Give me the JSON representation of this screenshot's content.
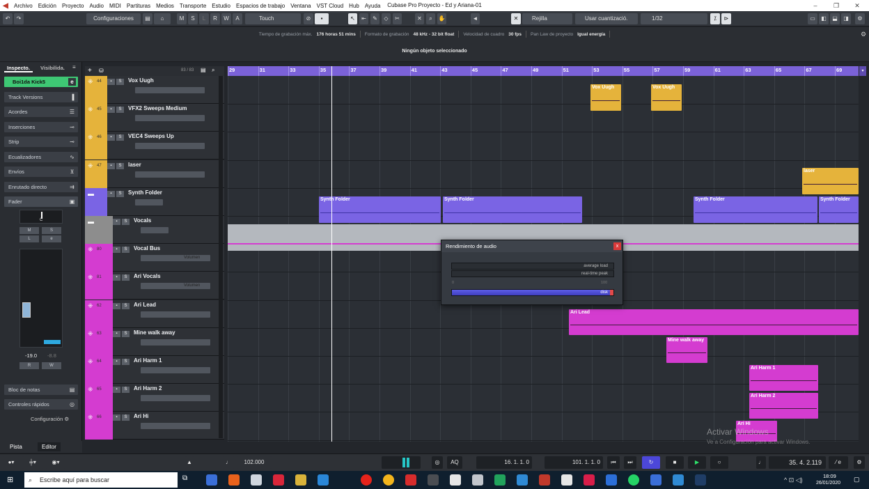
{
  "window": {
    "title": "Cubase Pro Proyecto - Ed y Ariana-01",
    "menu": [
      "Archivo",
      "Edición",
      "Proyecto",
      "Audio",
      "MIDI",
      "Partituras",
      "Medios",
      "Transporte",
      "Estudio",
      "Espacios de trabajo",
      "Ventana",
      "VST Cloud",
      "Hub",
      "Ayuda"
    ]
  },
  "toolbar": {
    "configs": "Configuraciones",
    "mode_letters": [
      "M",
      "S",
      "L",
      "R",
      "W",
      "A"
    ],
    "automation_mode": "Touch",
    "grid": "Rejilla",
    "quantize_use": "Usar cuantizació.",
    "quantize_value": "1/32"
  },
  "info": {
    "rec_time_label": "Tiempo de grabación máx.",
    "rec_time_value": "176 horas 51 mins",
    "format_label": "Formato de grabación",
    "format_value": "48 kHz - 32 bit float",
    "frame_label": "Velocidad de cuadro",
    "frame_value": "30 fps",
    "panlaw_label": "Pan Law de proyecto",
    "panlaw_value": "Igual energía",
    "selection": "Ningún objeto seleccionado"
  },
  "inspector": {
    "tab1": "Inspecto.",
    "tab2": "Visibilida.",
    "track_name": "Boi1da Kick5",
    "sections": [
      "Track Versions",
      "Acordes",
      "Inserciones",
      "Strip",
      "Ecualizadores",
      "Envíos",
      "Enrutado directo",
      "Fader"
    ],
    "fader_value": "-19.0",
    "fader_peak": "-8.8",
    "pan_value": "C",
    "bottom_sections": [
      "Bloc de notas",
      "Controles rápidos"
    ],
    "config_label": "Configuración",
    "bottom_tabs": [
      "Pista",
      "Editor"
    ]
  },
  "tracklist": {
    "count": "83 / 83",
    "tracks": [
      {
        "num": "44",
        "name": "Vox Uugh",
        "color": "#e5b33b"
      },
      {
        "num": "45",
        "name": "VFX2 Sweeps Medium",
        "color": "#e5b33b"
      },
      {
        "num": "46",
        "name": "VEC4 Sweeps Up",
        "color": "#e5b33b"
      },
      {
        "num": "47",
        "name": "laser",
        "color": "#e5b33b"
      },
      {
        "num": "",
        "name": "Synth Folder",
        "color": "#7a64e4"
      },
      {
        "num": "",
        "name": "Vocals",
        "color": "#8d8d8d"
      },
      {
        "num": "80",
        "name": "Vocal Bus",
        "color": "#d43cd0",
        "vol": "Volumen"
      },
      {
        "num": "81",
        "name": "Ari Vocals",
        "color": "#d43cd0",
        "vol": "Volumen"
      },
      {
        "num": "62",
        "name": "Ari Lead",
        "color": "#d43cd0"
      },
      {
        "num": "63",
        "name": "Mine walk away",
        "color": "#d43cd0"
      },
      {
        "num": "64",
        "name": "Ari Harm 1",
        "color": "#d43cd0"
      },
      {
        "num": "65",
        "name": "Ari Harm 2",
        "color": "#d43cd0"
      },
      {
        "num": "66",
        "name": "Ari Hi",
        "color": "#d43cd0"
      }
    ]
  },
  "ruler": {
    "bars": [
      "29",
      "31",
      "33",
      "35",
      "37",
      "39",
      "41",
      "43",
      "45",
      "47",
      "49",
      "51",
      "53",
      "55",
      "57",
      "59",
      "61",
      "63",
      "65",
      "67",
      "69"
    ]
  },
  "events": {
    "vox1": "Vox Uugh",
    "vox2": "Vox Uugh",
    "laser": "laser",
    "synth1": "Synth Folder",
    "synth2": "Synth Folder",
    "synth3": "Synth Folder",
    "synth4": "Synth Folder",
    "arilead": "Ari Lead",
    "mine": "Mine walk away",
    "harm1": "Ari Harm 1",
    "harm2": "Ari Harm 2",
    "arihi": "Ari Hi"
  },
  "perf_dialog": {
    "title": "Rendimiento de audio",
    "average": "average load",
    "peak": "real-time peak",
    "scale_min": "0",
    "scale_max": "100",
    "disk": "disk",
    "close": "x"
  },
  "watermark": {
    "line1": "Activar Windows",
    "line2": "Ve a Configuración para activar Windows."
  },
  "transport": {
    "tempo": "102.000",
    "aq": "AQ",
    "left_locator": "16. 1. 1.   0",
    "right_locator": "101. 1. 1.   0",
    "position": "35. 4. 2.119"
  },
  "taskbar": {
    "search_placeholder": "Escribe aquí para buscar",
    "time": "18:09",
    "date": "26/01/2020"
  }
}
